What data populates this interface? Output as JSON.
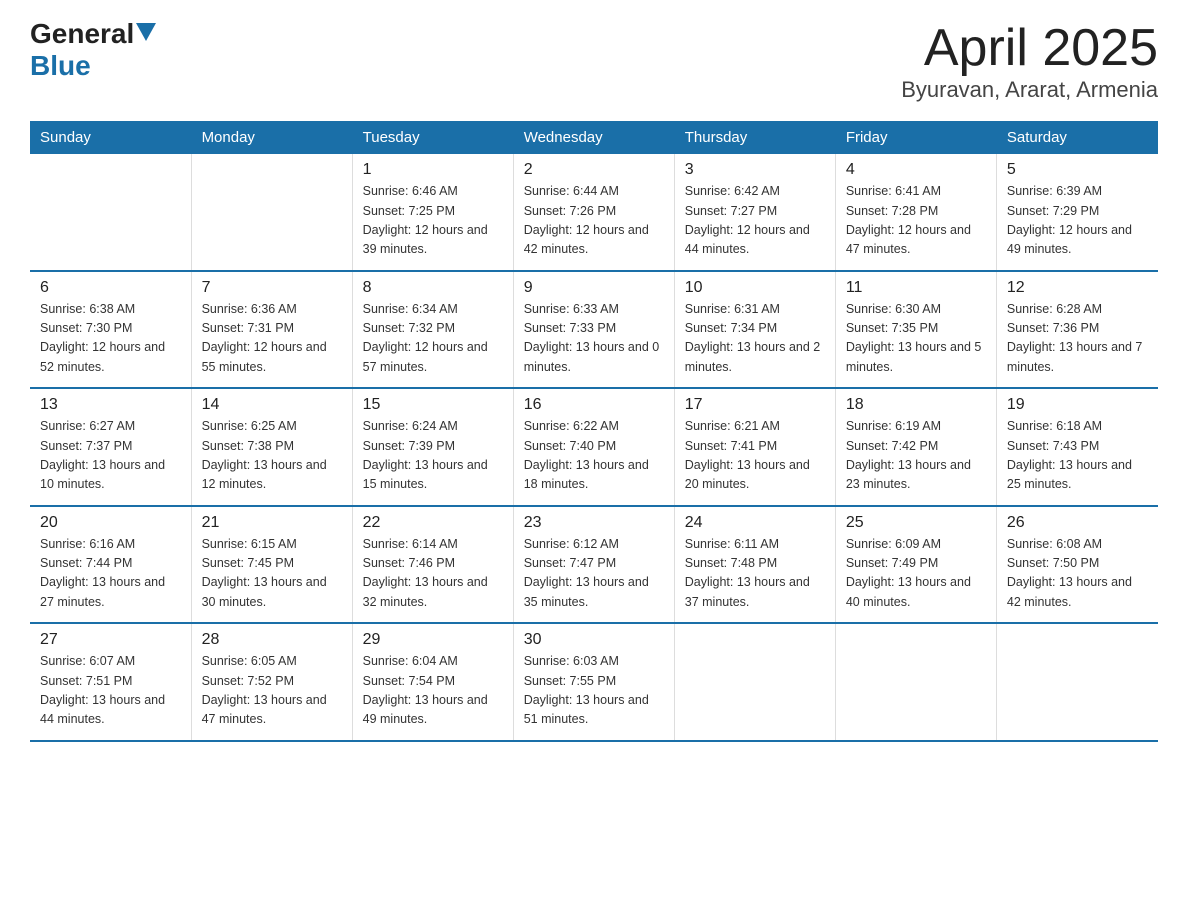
{
  "logo": {
    "general": "General",
    "blue": "Blue"
  },
  "title": "April 2025",
  "subtitle": "Byuravan, Ararat, Armenia",
  "days_of_week": [
    "Sunday",
    "Monday",
    "Tuesday",
    "Wednesday",
    "Thursday",
    "Friday",
    "Saturday"
  ],
  "weeks": [
    [
      {
        "day": "",
        "detail": ""
      },
      {
        "day": "",
        "detail": ""
      },
      {
        "day": "1",
        "detail": "Sunrise: 6:46 AM\nSunset: 7:25 PM\nDaylight: 12 hours\nand 39 minutes."
      },
      {
        "day": "2",
        "detail": "Sunrise: 6:44 AM\nSunset: 7:26 PM\nDaylight: 12 hours\nand 42 minutes."
      },
      {
        "day": "3",
        "detail": "Sunrise: 6:42 AM\nSunset: 7:27 PM\nDaylight: 12 hours\nand 44 minutes."
      },
      {
        "day": "4",
        "detail": "Sunrise: 6:41 AM\nSunset: 7:28 PM\nDaylight: 12 hours\nand 47 minutes."
      },
      {
        "day": "5",
        "detail": "Sunrise: 6:39 AM\nSunset: 7:29 PM\nDaylight: 12 hours\nand 49 minutes."
      }
    ],
    [
      {
        "day": "6",
        "detail": "Sunrise: 6:38 AM\nSunset: 7:30 PM\nDaylight: 12 hours\nand 52 minutes."
      },
      {
        "day": "7",
        "detail": "Sunrise: 6:36 AM\nSunset: 7:31 PM\nDaylight: 12 hours\nand 55 minutes."
      },
      {
        "day": "8",
        "detail": "Sunrise: 6:34 AM\nSunset: 7:32 PM\nDaylight: 12 hours\nand 57 minutes."
      },
      {
        "day": "9",
        "detail": "Sunrise: 6:33 AM\nSunset: 7:33 PM\nDaylight: 13 hours\nand 0 minutes."
      },
      {
        "day": "10",
        "detail": "Sunrise: 6:31 AM\nSunset: 7:34 PM\nDaylight: 13 hours\nand 2 minutes."
      },
      {
        "day": "11",
        "detail": "Sunrise: 6:30 AM\nSunset: 7:35 PM\nDaylight: 13 hours\nand 5 minutes."
      },
      {
        "day": "12",
        "detail": "Sunrise: 6:28 AM\nSunset: 7:36 PM\nDaylight: 13 hours\nand 7 minutes."
      }
    ],
    [
      {
        "day": "13",
        "detail": "Sunrise: 6:27 AM\nSunset: 7:37 PM\nDaylight: 13 hours\nand 10 minutes."
      },
      {
        "day": "14",
        "detail": "Sunrise: 6:25 AM\nSunset: 7:38 PM\nDaylight: 13 hours\nand 12 minutes."
      },
      {
        "day": "15",
        "detail": "Sunrise: 6:24 AM\nSunset: 7:39 PM\nDaylight: 13 hours\nand 15 minutes."
      },
      {
        "day": "16",
        "detail": "Sunrise: 6:22 AM\nSunset: 7:40 PM\nDaylight: 13 hours\nand 18 minutes."
      },
      {
        "day": "17",
        "detail": "Sunrise: 6:21 AM\nSunset: 7:41 PM\nDaylight: 13 hours\nand 20 minutes."
      },
      {
        "day": "18",
        "detail": "Sunrise: 6:19 AM\nSunset: 7:42 PM\nDaylight: 13 hours\nand 23 minutes."
      },
      {
        "day": "19",
        "detail": "Sunrise: 6:18 AM\nSunset: 7:43 PM\nDaylight: 13 hours\nand 25 minutes."
      }
    ],
    [
      {
        "day": "20",
        "detail": "Sunrise: 6:16 AM\nSunset: 7:44 PM\nDaylight: 13 hours\nand 27 minutes."
      },
      {
        "day": "21",
        "detail": "Sunrise: 6:15 AM\nSunset: 7:45 PM\nDaylight: 13 hours\nand 30 minutes."
      },
      {
        "day": "22",
        "detail": "Sunrise: 6:14 AM\nSunset: 7:46 PM\nDaylight: 13 hours\nand 32 minutes."
      },
      {
        "day": "23",
        "detail": "Sunrise: 6:12 AM\nSunset: 7:47 PM\nDaylight: 13 hours\nand 35 minutes."
      },
      {
        "day": "24",
        "detail": "Sunrise: 6:11 AM\nSunset: 7:48 PM\nDaylight: 13 hours\nand 37 minutes."
      },
      {
        "day": "25",
        "detail": "Sunrise: 6:09 AM\nSunset: 7:49 PM\nDaylight: 13 hours\nand 40 minutes."
      },
      {
        "day": "26",
        "detail": "Sunrise: 6:08 AM\nSunset: 7:50 PM\nDaylight: 13 hours\nand 42 minutes."
      }
    ],
    [
      {
        "day": "27",
        "detail": "Sunrise: 6:07 AM\nSunset: 7:51 PM\nDaylight: 13 hours\nand 44 minutes."
      },
      {
        "day": "28",
        "detail": "Sunrise: 6:05 AM\nSunset: 7:52 PM\nDaylight: 13 hours\nand 47 minutes."
      },
      {
        "day": "29",
        "detail": "Sunrise: 6:04 AM\nSunset: 7:54 PM\nDaylight: 13 hours\nand 49 minutes."
      },
      {
        "day": "30",
        "detail": "Sunrise: 6:03 AM\nSunset: 7:55 PM\nDaylight: 13 hours\nand 51 minutes."
      },
      {
        "day": "",
        "detail": ""
      },
      {
        "day": "",
        "detail": ""
      },
      {
        "day": "",
        "detail": ""
      }
    ]
  ]
}
